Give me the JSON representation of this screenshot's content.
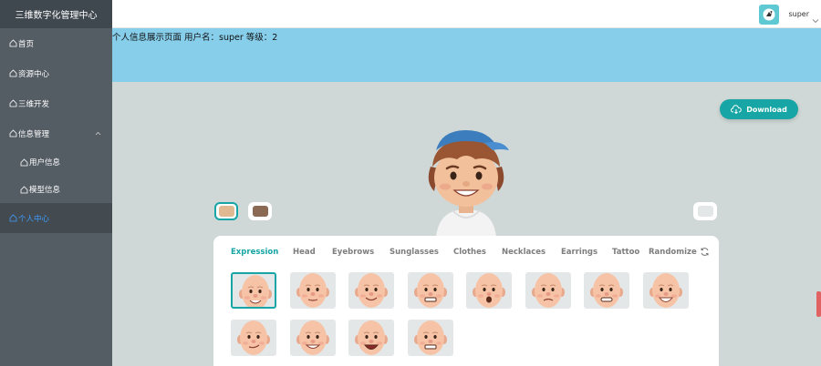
{
  "app": {
    "title": "三维数字化管理中心"
  },
  "sidebar": {
    "items": [
      {
        "label": "首页",
        "icon": "home-icon"
      },
      {
        "label": "资源中心",
        "icon": "home-icon"
      },
      {
        "label": "三维开发",
        "icon": "home-icon"
      },
      {
        "label": "信息管理",
        "icon": "home-icon",
        "expanded": true
      },
      {
        "label": "用户信息",
        "icon": "home-icon"
      },
      {
        "label": "模型信息",
        "icon": "home-icon"
      },
      {
        "label": "个人中心",
        "icon": "home-icon",
        "active": true
      }
    ],
    "colors": {
      "bg": "#545c64",
      "active_text": "#409eff"
    }
  },
  "header": {
    "username": "super"
  },
  "banner": {
    "info_text": "个人信息展示页面 用户名：super 等级：2"
  },
  "creator": {
    "download_label": "Download",
    "tabs": [
      "Expression",
      "Head",
      "Eyebrows",
      "Sunglasses",
      "Clothes",
      "Necklaces",
      "Earrings",
      "Tattoo",
      "Randomize"
    ],
    "active_tab": "Expression",
    "skin_colors": [
      "#e0b891",
      "#8a6a55",
      "#e4e7e8"
    ],
    "accent_color": "#17a5a5",
    "expressions": [
      "smile",
      "neutral",
      "happy",
      "grimace",
      "surprised",
      "sad",
      "teeth-grin",
      "big-smile",
      "smirk",
      "wide-grin",
      "laugh",
      "teeth"
    ]
  }
}
